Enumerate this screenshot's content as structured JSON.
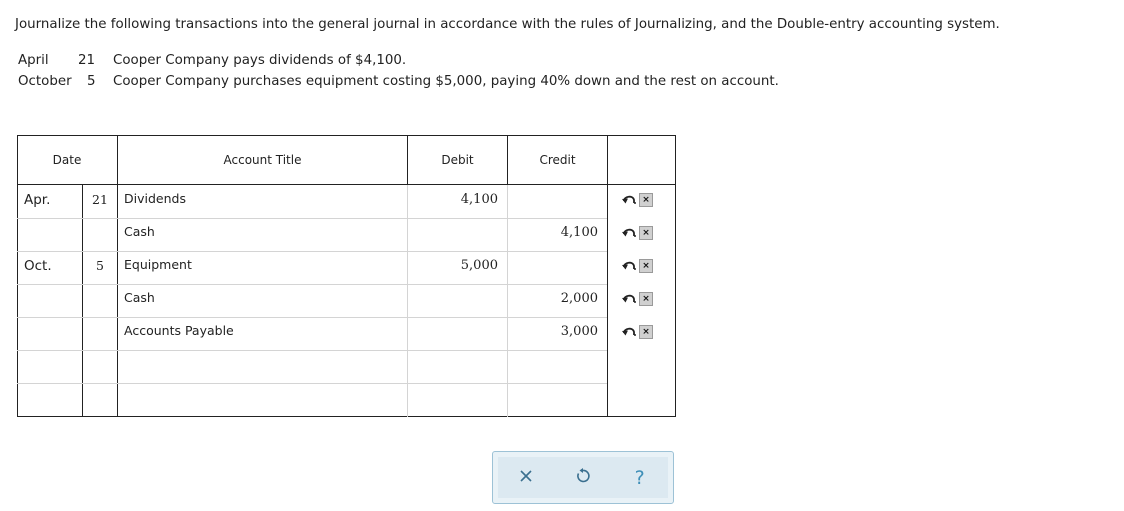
{
  "instructions": "Journalize the following transactions into the general journal in accordance with the rules of Journalizing, and the Double-entry accounting system.",
  "transactions": [
    {
      "month": "April",
      "day": "21",
      "description": "Cooper Company pays dividends of $4,100."
    },
    {
      "month": "October",
      "day": "5",
      "description": "Cooper Company purchases equipment costing $5,000, paying 40% down and the rest on account."
    }
  ],
  "journal": {
    "headers": {
      "date": "Date",
      "account": "Account Title",
      "debit": "Debit",
      "credit": "Credit"
    },
    "rows": [
      {
        "month": "Apr.",
        "day": "21",
        "account": "Dividends",
        "debit": "4,100",
        "credit": ""
      },
      {
        "month": "",
        "day": "",
        "account": "Cash",
        "debit": "",
        "credit": "4,100"
      },
      {
        "month": "Oct.",
        "day": "5",
        "account": "Equipment",
        "debit": "5,000",
        "credit": ""
      },
      {
        "month": "",
        "day": "",
        "account": "Cash",
        "debit": "",
        "credit": "2,000"
      },
      {
        "month": "",
        "day": "",
        "account": "Accounts Payable",
        "debit": "",
        "credit": "3,000"
      },
      {
        "month": "",
        "day": "",
        "account": "",
        "debit": "",
        "credit": ""
      },
      {
        "month": "",
        "day": "",
        "account": "",
        "debit": "",
        "credit": ""
      }
    ],
    "row_actions": {
      "undo_icon": "undo-arrow-icon",
      "delete_glyph": "×"
    }
  },
  "toolbar": {
    "clear_icon": "close-icon",
    "reset_icon": "reset-icon",
    "help_glyph": "?"
  },
  "colors": {
    "grid": "#d4d4d4",
    "toolbar_border": "#9dc2d6",
    "toolbar_bg": "#dce9f1",
    "icon_blue": "#3e8fb8"
  }
}
